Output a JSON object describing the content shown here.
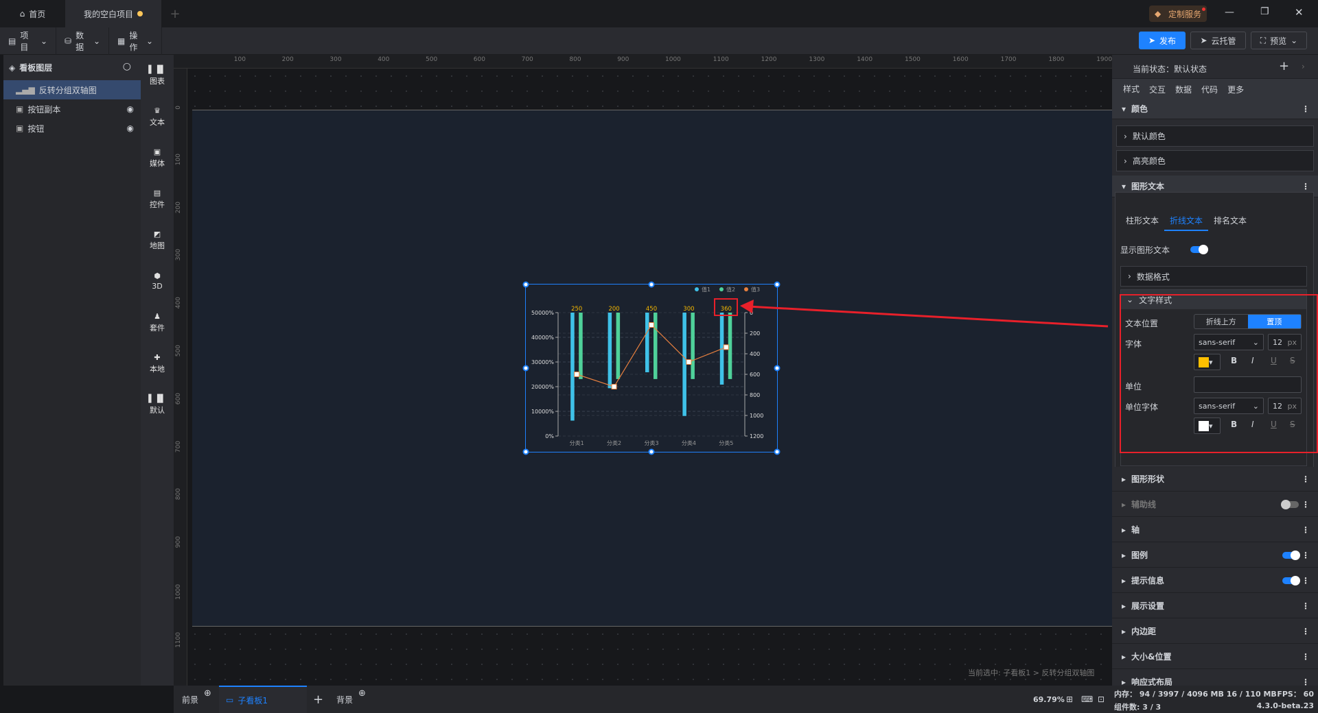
{
  "titlebar": {
    "home": "首页",
    "project_tab": "我的空白项目",
    "custom_service": "定制服务"
  },
  "toolbar": {
    "menus": [
      "项目",
      "数据",
      "操作"
    ],
    "publish": "发布",
    "cloud": "云托管",
    "preview": "预览"
  },
  "layers": {
    "title": "看板图层",
    "items": [
      "反转分组双轴图",
      "按钮副本",
      "按钮"
    ]
  },
  "components": [
    "图表",
    "文本",
    "媒体",
    "控件",
    "地图",
    "3D",
    "套件",
    "本地",
    "默认"
  ],
  "ruler": {
    "top": [
      "100",
      "200",
      "300",
      "400",
      "500",
      "600",
      "700",
      "800",
      "900",
      "1000",
      "1100",
      "1200",
      "1300",
      "1400",
      "1500",
      "1600",
      "1700",
      "1800",
      "1900"
    ],
    "left": [
      "0",
      "100",
      "200",
      "300",
      "400",
      "500",
      "600",
      "700",
      "800",
      "900",
      "1000",
      "1100"
    ]
  },
  "breadcrumb": "当前选中: 子看板1 > 反转分组双轴图",
  "bottom": {
    "foreground": "前景",
    "board": "子看板1",
    "background": "背景",
    "zoom": "69.79%"
  },
  "chart_data": {
    "type": "bar",
    "categories": [
      "分类1",
      "分类2",
      "分类3",
      "分类4",
      "分类5"
    ],
    "series": [
      {
        "name": "值1",
        "type": "bar",
        "axis": "right",
        "values": [
          1050,
          735,
          580,
          1005,
          700
        ],
        "color": "#3fc1e8"
      },
      {
        "name": "值2",
        "type": "bar",
        "axis": "right",
        "values": [
          646,
          646,
          646,
          646,
          646
        ],
        "color": "#4fd19a"
      },
      {
        "name": "值3",
        "type": "line",
        "axis": "left",
        "values": [
          250,
          200,
          450,
          300,
          360
        ],
        "color": "#e8803f"
      }
    ],
    "data_labels": [
      "250",
      "200",
      "450",
      "300",
      "360"
    ],
    "label_color": "#f5b800",
    "left_axis": {
      "ticks": [
        "0%",
        "10000%",
        "20000%",
        "30000%",
        "40000%",
        "50000%"
      ],
      "range": [
        0,
        500
      ]
    },
    "right_axis": {
      "ticks": [
        "0",
        "200",
        "400",
        "600",
        "800",
        "1000",
        "1200"
      ],
      "range": [
        0,
        1200
      ],
      "inverse": true
    },
    "legend": "top-right"
  },
  "right": {
    "state": "当前状态：默认状态",
    "tabs": [
      "样式",
      "交互",
      "数据",
      "代码",
      "更多"
    ],
    "color_section": "颜色",
    "default_color": "默认颜色",
    "highlight_color": "高亮颜色",
    "graphic_text": "图形文本",
    "text_tabs": [
      "柱形文本",
      "折线文本",
      "排名文本"
    ],
    "show_text": "显示图形文本",
    "data_format": "数据格式",
    "text_style": "文字样式",
    "position_label": "文本位置",
    "position_opts": [
      "折线上方",
      "置顶"
    ],
    "font_label": "字体",
    "font": "sans-serif",
    "size": "12",
    "px": "px",
    "unit_label": "单位",
    "unit_value": "",
    "unit_font_label": "单位字体",
    "unit_font": "sans-serif",
    "unit_size": "12",
    "font_color": "#ffc000",
    "unit_color": "#ffffff",
    "sections": [
      "图形形状",
      "辅助线",
      "轴",
      "图例",
      "提示信息",
      "展示设置",
      "内边距",
      "大小&位置",
      "响应式布局"
    ]
  },
  "status": {
    "memory": "内存：  94 / 3997 / 4096 MB  16 / 110 MB",
    "fps": "FPS：  60",
    "count": "组件数: 3 / 3",
    "version": "4.3.0-beta.23"
  }
}
